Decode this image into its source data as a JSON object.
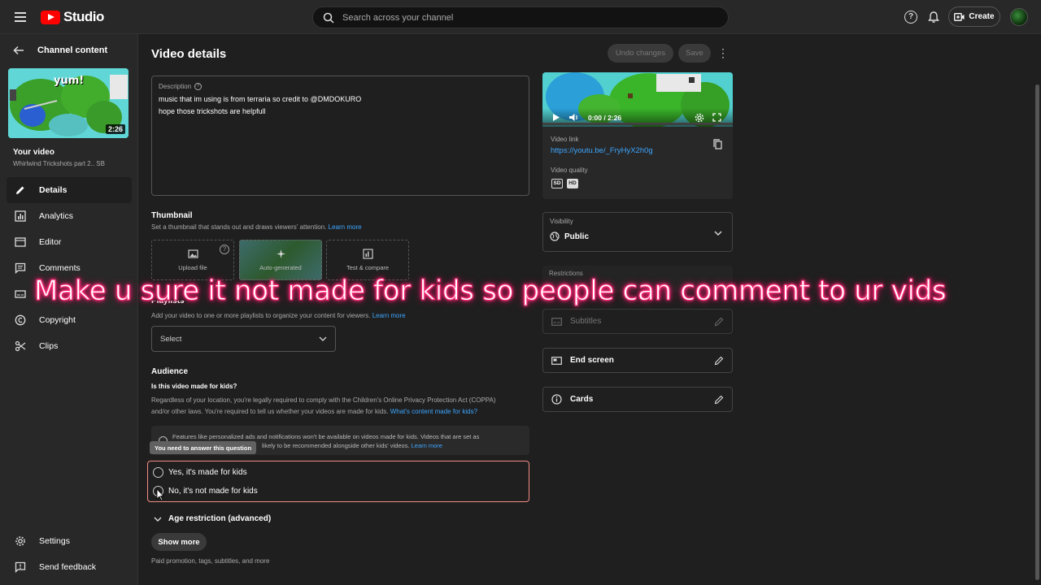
{
  "topbar": {
    "logo_text": "Studio",
    "search_placeholder": "Search across your channel",
    "create_label": "Create"
  },
  "sidebar": {
    "back_label": "Channel content",
    "thumb_duration": "2:26",
    "thumb_text": "yum!",
    "your_video_label": "Your video",
    "video_title": "Whirlwind Trickshots part 2.. SB",
    "items": [
      {
        "label": "Details",
        "icon": "pencil-icon",
        "active": true
      },
      {
        "label": "Analytics",
        "icon": "analytics-icon"
      },
      {
        "label": "Editor",
        "icon": "film-icon"
      },
      {
        "label": "Comments",
        "icon": "comment-icon"
      },
      {
        "label": "",
        "icon": "subtitles-icon"
      },
      {
        "label": "Copyright",
        "icon": "copyright-icon"
      },
      {
        "label": "Clips",
        "icon": "scissors-icon"
      }
    ],
    "footer": [
      {
        "label": "Settings",
        "icon": "gear-icon"
      },
      {
        "label": "Send feedback",
        "icon": "feedback-icon"
      }
    ]
  },
  "main": {
    "title": "Video details",
    "undo_label": "Undo changes",
    "save_label": "Save",
    "description": {
      "label": "Description",
      "lines": [
        "music that im using is from terraria so credit to @DMDOKURO",
        "hope those trickshots are helpfull"
      ]
    },
    "thumbnail": {
      "title": "Thumbnail",
      "subtitle": "Set a thumbnail that stands out and draws viewers' attention.",
      "learn_more": "Learn more",
      "options": [
        "Upload file",
        "Auto-generated",
        "Test & compare"
      ]
    },
    "playlists": {
      "title_fragment": "Playlists",
      "subtitle": "Add your video to one or more playlists to organize your content for viewers.",
      "learn_more": "Learn more",
      "select_value": "Select"
    },
    "audience": {
      "title": "Audience",
      "question": "Is this video made for kids?",
      "legal_text_1": "Regardless of your location, you're legally required to comply with the Children's Online Privacy Protection Act (COPPA)",
      "legal_text_2": "and/or other laws. You're required to tell us whether your videos are made for kids.",
      "legal_link": "What's content made for kids?",
      "info_line_1": "Features like personalized ads and notifications won't be available on videos made for kids. Videos that are set as",
      "info_line_2": "likely to be recommended alongside other kids' videos.",
      "info_link": "Learn more",
      "tooltip": "You need to answer this question",
      "option_yes": "Yes, it's made for kids",
      "option_no": "No, it's not made for kids"
    },
    "age_restriction_label": "Age restriction (advanced)",
    "show_more_label": "Show more",
    "show_more_sub": "Paid promotion, tags, subtitles, and more"
  },
  "right": {
    "player_time": "0:00 / 2:26",
    "video_link_label": "Video link",
    "video_link": "https://youtu.be/_FryHyX2h0g",
    "video_quality_label": "Video quality",
    "quality_badges": [
      "SD",
      "HD"
    ],
    "visibility_label": "Visibility",
    "visibility_value": "Public",
    "restrictions_label": "Restrictions",
    "subtitles_label": "Subtitles",
    "end_screen_label": "End screen",
    "cards_label": "Cards"
  },
  "overlay_caption": "Make u sure it not made for kids so people can comment to ur vids",
  "colors": {
    "accent_link": "#3ea6ff",
    "error_border": "#f28b82",
    "brand_red": "#ff0000",
    "caption_glow": "#ff2d79"
  }
}
